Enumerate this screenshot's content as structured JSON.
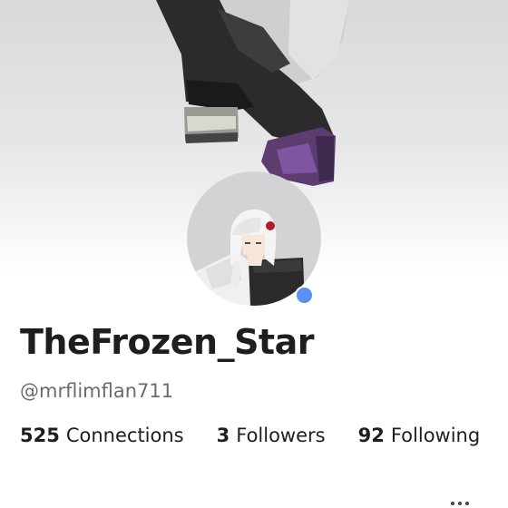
{
  "profile": {
    "display_name": "TheFrozen_Star",
    "username": "@mrflimflan711",
    "online_status_color": "#5b8ff2"
  },
  "stats": {
    "connections": {
      "count": "525",
      "label": "Connections"
    },
    "followers": {
      "count": "3",
      "label": "Followers"
    },
    "following": {
      "count": "92",
      "label": "Following"
    }
  },
  "icons": {
    "more": "more-horizontal-icon"
  },
  "colors": {
    "text_primary": "#1e1e1e",
    "text_secondary": "#6b6b6b",
    "avatar_bg": "#d3d3d5"
  }
}
